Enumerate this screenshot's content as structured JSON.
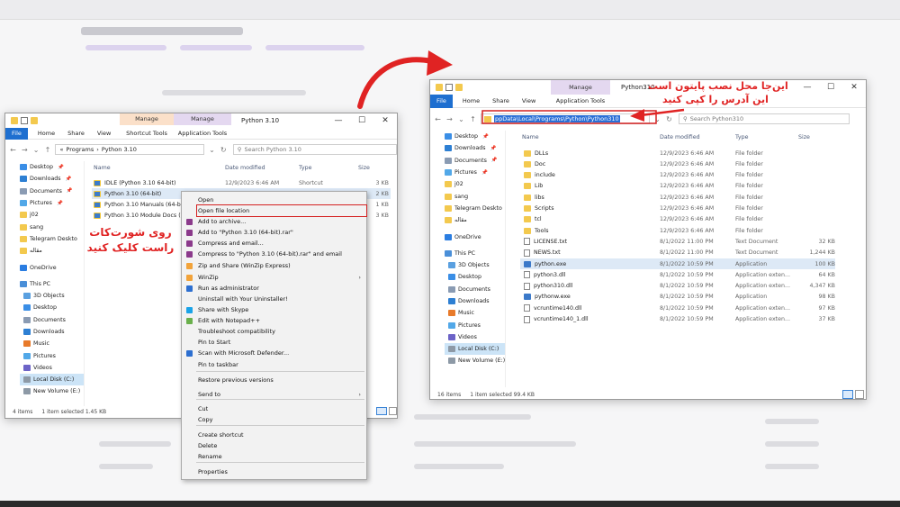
{
  "left_window": {
    "manage_tab_1": "Manage",
    "manage_tab_2": "Manage",
    "title": "Python 3.10",
    "ribbon": {
      "file": "File",
      "home": "Home",
      "share": "Share",
      "view": "View",
      "shortcut_tools": "Shortcut Tools",
      "application_tools": "Application Tools"
    },
    "breadcrumb": {
      "root": "Programs",
      "current": "Python 3.10"
    },
    "search_placeholder": "Search Python 3.10",
    "nav": [
      {
        "label": "Desktop",
        "icon": "desktop-icon",
        "pinned": true
      },
      {
        "label": "Downloads",
        "icon": "downloads-icon",
        "pinned": true
      },
      {
        "label": "Documents",
        "icon": "documents-icon",
        "pinned": true
      },
      {
        "label": "Pictures",
        "icon": "pictures-icon",
        "pinned": true
      },
      {
        "label": "j02",
        "icon": "folder-icon",
        "pinned": false
      },
      {
        "label": "sang",
        "icon": "folder-icon",
        "pinned": false
      },
      {
        "label": "Telegram Deskto",
        "icon": "folder-icon",
        "pinned": false
      },
      {
        "label": "مقاله",
        "icon": "folder-icon",
        "pinned": false
      },
      {
        "label": "OneDrive",
        "icon": "onedrive-icon",
        "pinned": false
      },
      {
        "label": "This PC",
        "icon": "pc-icon",
        "pinned": false
      },
      {
        "label": "3D Objects",
        "icon": "cube-icon",
        "pinned": false
      },
      {
        "label": "Desktop",
        "icon": "desktop-icon",
        "pinned": false
      },
      {
        "label": "Documents",
        "icon": "documents-icon",
        "pinned": false
      },
      {
        "label": "Downloads",
        "icon": "downloads-icon",
        "pinned": false
      },
      {
        "label": "Music",
        "icon": "music-icon",
        "pinned": false
      },
      {
        "label": "Pictures",
        "icon": "pictures-icon",
        "pinned": false
      },
      {
        "label": "Videos",
        "icon": "videos-icon",
        "pinned": false
      },
      {
        "label": "Local Disk (C:)",
        "icon": "disk-icon",
        "pinned": false
      },
      {
        "label": "New Volume (E:)",
        "icon": "disk-icon",
        "pinned": false
      }
    ],
    "columns": {
      "name": "Name",
      "date": "Date modified",
      "type": "Type",
      "size": "Size"
    },
    "files": [
      {
        "name": "IDLE (Python 3.10 64-bit)",
        "date": "12/9/2023 6:46 AM",
        "type": "Shortcut",
        "size": "3 KB"
      },
      {
        "name": "Python 3.10 (64-bit)",
        "date": "12/9/2023 6:46 AM",
        "type": "Shortcut",
        "size": "2 KB"
      },
      {
        "name": "Python 3.10 Manuals (64-bit)",
        "date": "",
        "type": "",
        "size": "1 KB"
      },
      {
        "name": "Python 3.10 Module Docs (64-bit)",
        "date": "",
        "type": "",
        "size": "3 KB"
      }
    ],
    "status": {
      "items": "4 items",
      "selected": "1 item selected  1.45 KB"
    }
  },
  "context_menu": {
    "items": [
      {
        "label": "Open",
        "sub": false
      },
      {
        "label": "Open file location",
        "sub": false
      },
      {
        "label": "Add to archive...",
        "sub": false
      },
      {
        "label": "Add to \"Python 3.10 (64-bit).rar\"",
        "sub": false
      },
      {
        "label": "Compress and email...",
        "sub": false
      },
      {
        "label": "Compress to \"Python 3.10 (64-bit).rar\" and email",
        "sub": false
      },
      {
        "label": "Zip and Share (WinZip Express)",
        "sub": false
      },
      {
        "label": "WinZip",
        "sub": true
      },
      {
        "label": "Run as administrator",
        "sub": false
      },
      {
        "label": "Uninstall with Your Uninstaller!",
        "sub": false
      },
      {
        "label": "Share with Skype",
        "sub": false
      },
      {
        "label": "Edit with Notepad++",
        "sub": false
      },
      {
        "label": "Troubleshoot compatibility",
        "sub": false
      },
      {
        "label": "Pin to Start",
        "sub": false
      },
      {
        "label": "Scan with Microsoft Defender...",
        "sub": false
      },
      {
        "label": "Pin to taskbar",
        "sub": false
      },
      {
        "label": "Restore previous versions",
        "sub": false
      },
      {
        "label": "Send to",
        "sub": true
      },
      {
        "label": "Cut",
        "sub": false
      },
      {
        "label": "Copy",
        "sub": false
      },
      {
        "label": "Create shortcut",
        "sub": false
      },
      {
        "label": "Delete",
        "sub": false
      },
      {
        "label": "Rename",
        "sub": false
      },
      {
        "label": "Properties",
        "sub": false
      }
    ]
  },
  "right_window": {
    "manage_tab": "Manage",
    "title": "Python310",
    "ribbon": {
      "file": "File",
      "home": "Home",
      "share": "Share",
      "view": "View",
      "application_tools": "Application Tools"
    },
    "address": "ppData\\Local\\Programs\\Python\\Python310",
    "search_placeholder": "Search Python310",
    "nav": [
      {
        "label": "Desktop",
        "icon": "desktop-icon",
        "pinned": true
      },
      {
        "label": "Downloads",
        "icon": "downloads-icon",
        "pinned": true
      },
      {
        "label": "Documents",
        "icon": "documents-icon",
        "pinned": true
      },
      {
        "label": "Pictures",
        "icon": "pictures-icon",
        "pinned": true
      },
      {
        "label": "j02",
        "icon": "folder-icon",
        "pinned": false
      },
      {
        "label": "sang",
        "icon": "folder-icon",
        "pinned": false
      },
      {
        "label": "Telegram Deskto",
        "icon": "folder-icon",
        "pinned": false
      },
      {
        "label": "مقاله",
        "icon": "folder-icon",
        "pinned": false
      },
      {
        "label": "OneDrive",
        "icon": "onedrive-icon",
        "pinned": false
      },
      {
        "label": "This PC",
        "icon": "pc-icon",
        "pinned": false
      },
      {
        "label": "3D Objects",
        "icon": "cube-icon",
        "pinned": false
      },
      {
        "label": "Desktop",
        "icon": "desktop-icon",
        "pinned": false
      },
      {
        "label": "Documents",
        "icon": "documents-icon",
        "pinned": false
      },
      {
        "label": "Downloads",
        "icon": "downloads-icon",
        "pinned": false
      },
      {
        "label": "Music",
        "icon": "music-icon",
        "pinned": false
      },
      {
        "label": "Pictures",
        "icon": "pictures-icon",
        "pinned": false
      },
      {
        "label": "Videos",
        "icon": "videos-icon",
        "pinned": false
      },
      {
        "label": "Local Disk (C:)",
        "icon": "disk-icon",
        "pinned": false
      },
      {
        "label": "New Volume (E:)",
        "icon": "disk-icon",
        "pinned": false
      }
    ],
    "columns": {
      "name": "Name",
      "date": "Date modified",
      "type": "Type",
      "size": "Size"
    },
    "files": [
      {
        "name": "DLLs",
        "date": "12/9/2023 6:46 AM",
        "type": "File folder",
        "size": "",
        "icon": "folder"
      },
      {
        "name": "Doc",
        "date": "12/9/2023 6:46 AM",
        "type": "File folder",
        "size": "",
        "icon": "folder"
      },
      {
        "name": "include",
        "date": "12/9/2023 6:46 AM",
        "type": "File folder",
        "size": "",
        "icon": "folder"
      },
      {
        "name": "Lib",
        "date": "12/9/2023 6:46 AM",
        "type": "File folder",
        "size": "",
        "icon": "folder"
      },
      {
        "name": "libs",
        "date": "12/9/2023 6:46 AM",
        "type": "File folder",
        "size": "",
        "icon": "folder"
      },
      {
        "name": "Scripts",
        "date": "12/9/2023 6:46 AM",
        "type": "File folder",
        "size": "",
        "icon": "folder"
      },
      {
        "name": "tcl",
        "date": "12/9/2023 6:46 AM",
        "type": "File folder",
        "size": "",
        "icon": "folder"
      },
      {
        "name": "Tools",
        "date": "12/9/2023 6:46 AM",
        "type": "File folder",
        "size": "",
        "icon": "folder"
      },
      {
        "name": "LICENSE.txt",
        "date": "8/1/2022 11:00 PM",
        "type": "Text Document",
        "size": "32 KB",
        "icon": "doc"
      },
      {
        "name": "NEWS.txt",
        "date": "8/1/2022 11:00 PM",
        "type": "Text Document",
        "size": "1,244 KB",
        "icon": "doc"
      },
      {
        "name": "python.exe",
        "date": "8/1/2022 10:59 PM",
        "type": "Application",
        "size": "100 KB",
        "icon": "app"
      },
      {
        "name": "python3.dll",
        "date": "8/1/2022 10:59 PM",
        "type": "Application exten...",
        "size": "64 KB",
        "icon": "dll"
      },
      {
        "name": "python310.dll",
        "date": "8/1/2022 10:59 PM",
        "type": "Application exten...",
        "size": "4,347 KB",
        "icon": "dll"
      },
      {
        "name": "pythonw.exe",
        "date": "8/1/2022 10:59 PM",
        "type": "Application",
        "size": "98 KB",
        "icon": "app"
      },
      {
        "name": "vcruntime140.dll",
        "date": "8/1/2022 10:59 PM",
        "type": "Application exten...",
        "size": "97 KB",
        "icon": "dll"
      },
      {
        "name": "vcruntime140_1.dll",
        "date": "8/1/2022 10:59 PM",
        "type": "Application exten...",
        "size": "37 KB",
        "icon": "dll"
      }
    ],
    "status": {
      "items": "16 items",
      "selected": "1 item selected  99.4 KB"
    }
  },
  "annotations": {
    "left_line1": "روی شورت‌کات",
    "left_line2": "راست کلیک کنید",
    "right_line1": "این‌جا محل نصب پایتون است",
    "right_line2": "این آدرس را کپی کنید"
  },
  "colors": {
    "annotation_red": "#e02323",
    "file_tab_blue": "#1e6fd0",
    "selection_blue": "#cce4f7"
  }
}
